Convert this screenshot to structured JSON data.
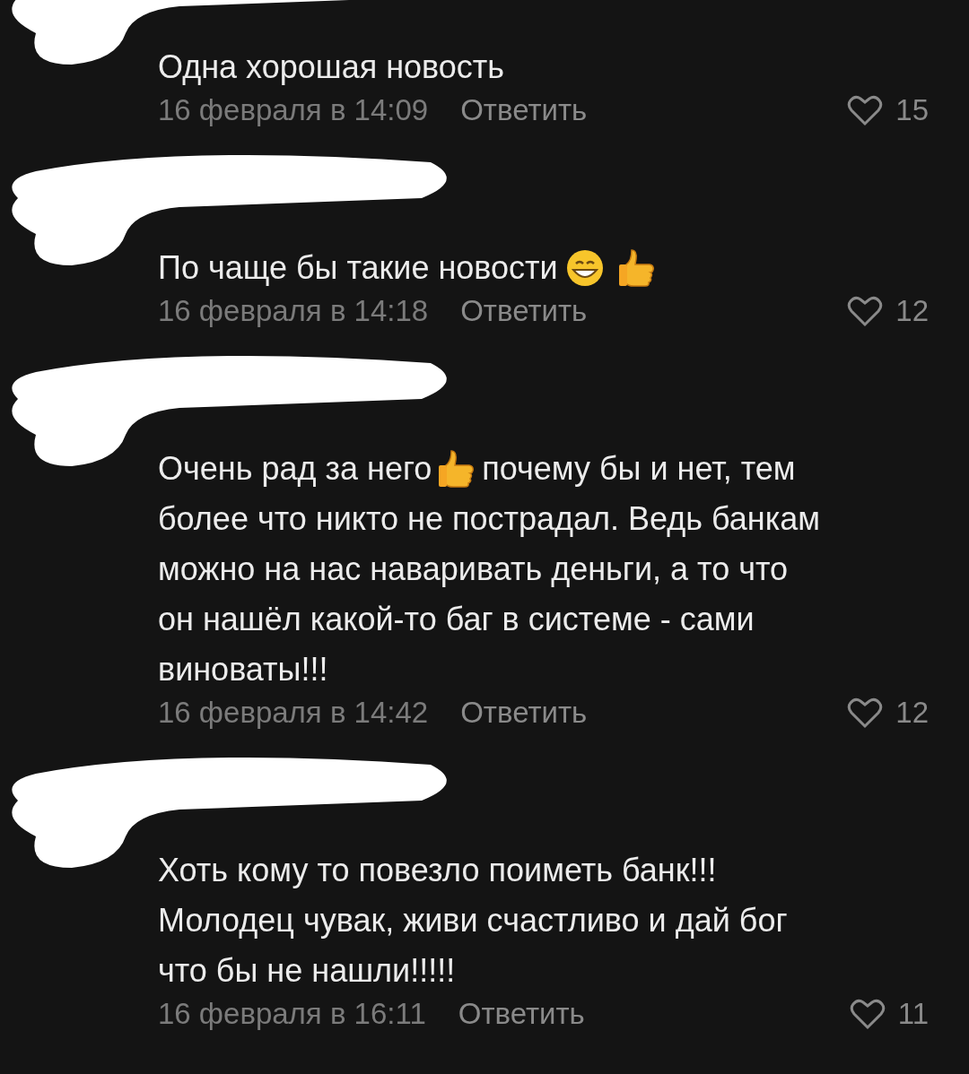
{
  "comments": [
    {
      "redacted": true,
      "lines": [
        [
          {
            "kind": "text",
            "text": "Одна хорошая новость"
          }
        ]
      ],
      "date": "16 февраля в 14:09",
      "reply": "Ответить",
      "likes": "15"
    },
    {
      "redacted": true,
      "lines": [
        [
          {
            "kind": "text",
            "text": "По чаще бы такие новости"
          },
          {
            "kind": "grin"
          },
          {
            "kind": "thumbsup"
          }
        ]
      ],
      "date": "16 февраля в 14:18",
      "reply": "Ответить",
      "likes": "12"
    },
    {
      "redacted": true,
      "lines": [
        [
          {
            "kind": "text",
            "text": "Очень рад за него"
          },
          {
            "kind": "thumbsup"
          },
          {
            "kind": "text",
            "text": "почему бы и нет, тем"
          }
        ],
        [
          {
            "kind": "text",
            "text": "более что никто не пострадал. Ведь банкам"
          }
        ],
        [
          {
            "kind": "text",
            "text": "можно на нас наваривать деньги, а то что"
          }
        ],
        [
          {
            "kind": "text",
            "text": "он нашёл какой-то баг в системе - сами"
          }
        ],
        [
          {
            "kind": "text",
            "text": "виноваты!!!"
          }
        ]
      ],
      "date": "16 февраля в 14:42",
      "reply": "Ответить",
      "likes": "12"
    },
    {
      "redacted": true,
      "lines": [
        [
          {
            "kind": "text",
            "text": "Хоть кому то повезло поиметь банк!!!"
          }
        ],
        [
          {
            "kind": "text",
            "text": "Молодец чувак, живи счастливо и дай бог"
          }
        ],
        [
          {
            "kind": "text",
            "text": "что бы не нашли!!!!!"
          }
        ]
      ],
      "date": "16 февраля в 16:11",
      "reply": "Ответить",
      "likes": "11"
    }
  ]
}
